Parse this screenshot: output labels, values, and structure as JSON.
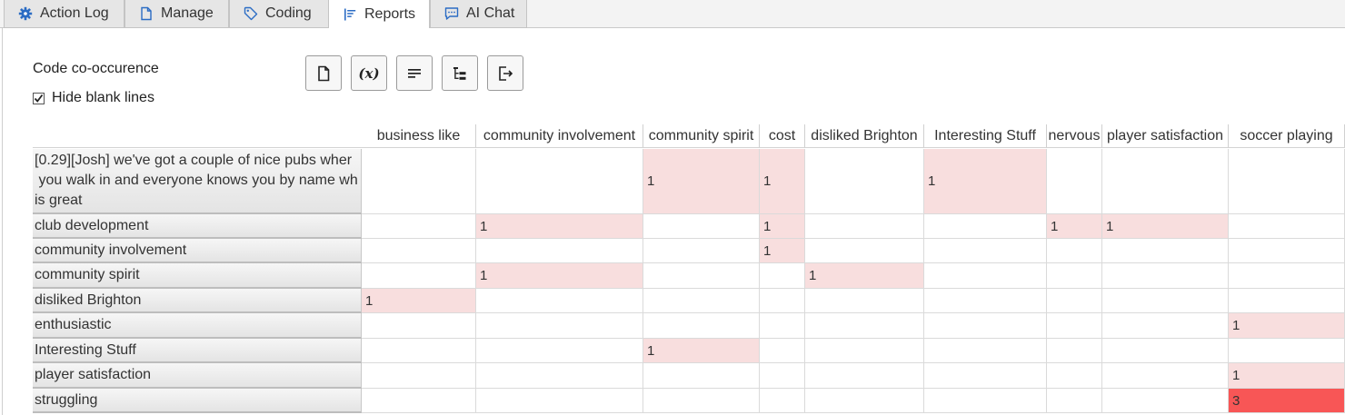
{
  "tabs": [
    {
      "label": "Action Log",
      "icon": "gear-icon",
      "active": false
    },
    {
      "label": "Manage",
      "icon": "document-icon",
      "active": false
    },
    {
      "label": "Coding",
      "icon": "tag-icon",
      "active": false
    },
    {
      "label": "Reports",
      "icon": "report-list-icon",
      "active": true
    },
    {
      "label": "AI Chat",
      "icon": "chat-icon",
      "active": false
    }
  ],
  "report": {
    "title": "Code co-occurence",
    "hide_blank_label": "Hide blank lines",
    "hide_blank_checked": true,
    "toolbar": [
      {
        "icon": "document-icon",
        "glyph": ""
      },
      {
        "icon": "variable-icon",
        "glyph": "(x)"
      },
      {
        "icon": "text-lines-icon",
        "glyph": ""
      },
      {
        "icon": "tree-icon",
        "glyph": ""
      },
      {
        "icon": "export-icon",
        "glyph": ""
      }
    ]
  },
  "colors": {
    "tab_icon": "#2b6cc4",
    "cell_low": "#f8dede",
    "cell_high": "#f85656"
  },
  "table": {
    "columns": [
      "business like",
      "community involvement",
      "community spirit",
      "cost",
      "disliked Brighton",
      "Interesting Stuff",
      "nervous",
      "player satisfaction",
      "soccer playing"
    ],
    "rows": [
      {
        "label": "[0.29][Josh] we've got a couple of nice pubs where you walk in and everyone knows you by name which is great",
        "label_lines": [
          "[0.29][Josh] we've got a couple of nice pubs wher",
          " you walk in and everyone knows you by name wh",
          "is great"
        ],
        "values": [
          "",
          "",
          "1",
          "1",
          "",
          "1",
          "",
          "",
          ""
        ]
      },
      {
        "label": "club development",
        "values": [
          "",
          "1",
          "",
          "1",
          "",
          "",
          "1",
          "1",
          ""
        ]
      },
      {
        "label": "community involvement",
        "values": [
          "",
          "",
          "",
          "1",
          "",
          "",
          "",
          "",
          ""
        ]
      },
      {
        "label": "community spirit",
        "values": [
          "",
          "1",
          "",
          "",
          "1",
          "",
          "",
          "",
          ""
        ]
      },
      {
        "label": "disliked Brighton",
        "values": [
          "1",
          "",
          "",
          "",
          "",
          "",
          "",
          "",
          ""
        ]
      },
      {
        "label": "enthusiastic",
        "values": [
          "",
          "",
          "",
          "",
          "",
          "",
          "",
          "",
          "1"
        ]
      },
      {
        "label": "Interesting Stuff",
        "values": [
          "",
          "",
          "1",
          "",
          "",
          "",
          "",
          "",
          ""
        ]
      },
      {
        "label": "player satisfaction",
        "values": [
          "",
          "",
          "",
          "",
          "",
          "",
          "",
          "",
          "1"
        ]
      },
      {
        "label": "struggling",
        "values": [
          "",
          "",
          "",
          "",
          "",
          "",
          "",
          "",
          "3"
        ]
      }
    ]
  }
}
